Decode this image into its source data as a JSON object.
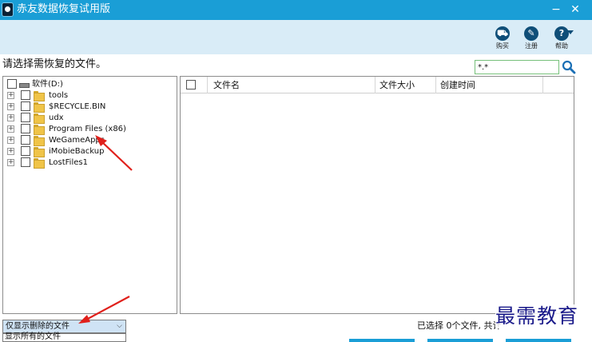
{
  "window": {
    "title": "赤友数据恢复试用版",
    "minimize": "−",
    "close": "✕"
  },
  "toolbar": {
    "buy_label": "购买",
    "register_label": "注册",
    "help_label": "帮助"
  },
  "prompt": "请选择需恢复的文件。",
  "filter": {
    "value": "*.*"
  },
  "tree": {
    "root": "软件(D:)",
    "items": [
      {
        "label": "tools"
      },
      {
        "label": "$RECYCLE.BIN"
      },
      {
        "label": "udx"
      },
      {
        "label": "Program Files (x86)"
      },
      {
        "label": "WeGameApps"
      },
      {
        "label": "iMobieBackup"
      },
      {
        "label": "LostFiles1"
      }
    ]
  },
  "files": {
    "columns": [
      "文件名",
      "文件大小",
      "创建时间"
    ]
  },
  "filter_select": {
    "selected": "仅显示删除的文件",
    "options": [
      "显示所有的文件"
    ]
  },
  "status": "已选择 0个文件, 共计",
  "watermark": "最需教育",
  "colors": {
    "titlebar": "#1a9ed6",
    "toolbar": "#d9ecf7",
    "annotation_arrow": "#e0201b"
  },
  "icons": {
    "app": "app-logo-icon",
    "buy": "cart-icon",
    "register": "register-icon",
    "help": "help-icon",
    "search": "magnifier-icon"
  }
}
